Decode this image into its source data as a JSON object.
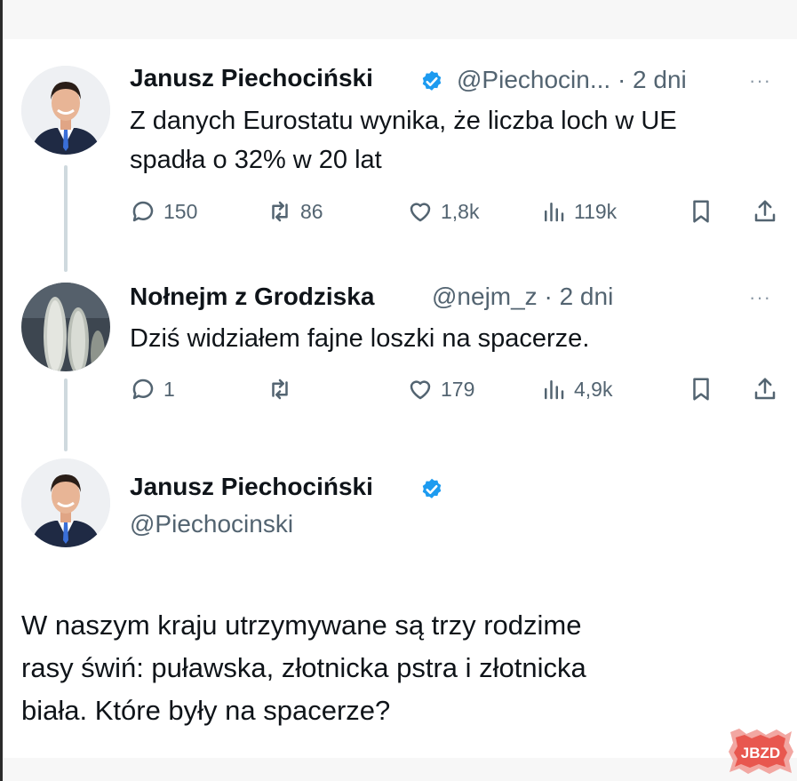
{
  "tweets": [
    {
      "author": "Janusz Piechociński",
      "meta": "@Piechocin... · 2 dni",
      "more": "···",
      "text": [
        "Z danych Eurostatu wynika, że liczba loch w UE",
        "spadła o 32% w 20 lat"
      ],
      "stats": {
        "replies": "150",
        "retweets": "86",
        "likes": "1,8k",
        "views": "119k"
      }
    },
    {
      "author": "Nołnejm z Grodziska",
      "meta": "@nejm_z · 2 dni",
      "more": "···",
      "text": [
        "Dziś widziałem fajne loszki na spacerze."
      ],
      "stats": {
        "replies": "1",
        "retweets": "",
        "likes": "179",
        "views": "4,9k"
      }
    }
  ],
  "main_tweet": {
    "author": "Janusz Piechociński",
    "handle": "@Piechocinski",
    "text": [
      "W naszym kraju utrzymywane są trzy rodzime",
      "rasy świń: puławska, złotnicka pstra i złotnicka",
      "biała. Które były na spacerze?"
    ]
  },
  "watermark": "JBZD",
  "colors": {
    "verified": "#1d9bf0",
    "muted": "#536471",
    "thread_line": "#cfd9de",
    "watermark": "#e8574f"
  }
}
